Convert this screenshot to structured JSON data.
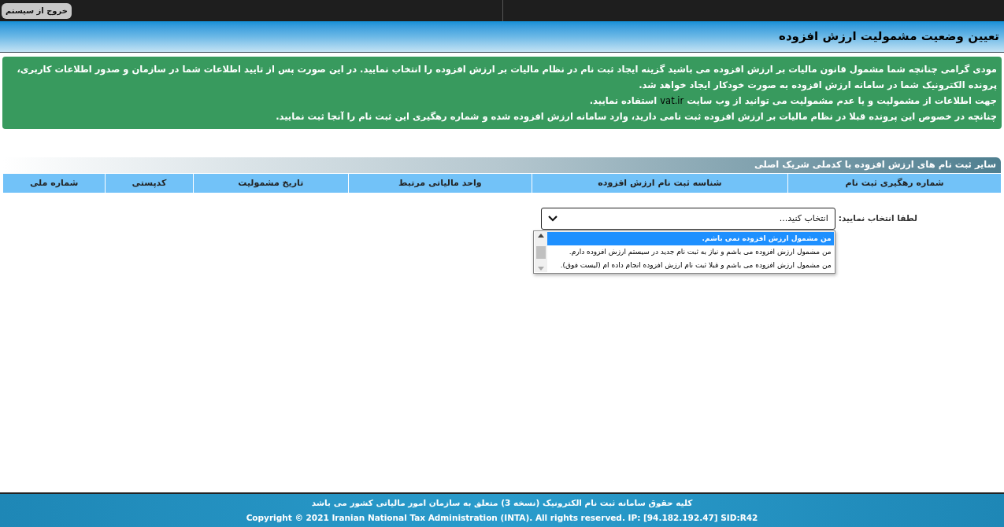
{
  "logout_button": "خروج از سیستم",
  "page_title": "تعیین وضعیت مشمولیت ارزش افزوده",
  "notice": {
    "lines": [
      {
        "text": "مودی گرامی چنانچه شما مشمول قانون مالیات بر ارزش افزوده می باشید گزینه ایجاد ثبت نام در نظام مالیات بر ارزش افزوده را انتخاب نمایید. در این صورت پس از تایید اطلاعات شما در سازمان و صدور اطلاعات کاربری، پرونده الکترونیک شما در سامانه ارزش افزوده به صورت خودکار ایجاد خواهد شد."
      },
      {
        "text": "جهت اطلاعات از مشمولیت و یا عدم مشمولیت می توانید از وب سایت",
        "link": "vat.ir",
        "text_after": "استفاده نمایید."
      },
      {
        "text": "چنانچه در خصوص این پرونده قبلا در نظام مالیات بر ارزش افزوده ثبت نامی دارید، وارد سامانه ارزش افزوده شده و شماره رهگیری این ثبت نام را آنجا ثبت نمایید."
      }
    ]
  },
  "registrations": {
    "title": "سایر ثبت نام های ارزش افزوده با کدملی شریک اصلی",
    "columns": [
      "شماره رهگیری ثبت نام",
      "شناسه ثبت نام ارزش افزوده",
      "واحد مالیاتی مرتبط",
      "تاریخ مشمولیت",
      "کدپستی",
      "شماره ملی"
    ]
  },
  "selection": {
    "label": "لطفا انتخاب نمایید:",
    "value": "انتخاب کنید...",
    "expanded": true,
    "options": [
      {
        "label": "من مشمول ارزش افزوده نمی باشم.",
        "selected": true
      },
      {
        "label": "من مشمول ارزش افزوده می باشم و نیاز به ثبت نام جدید در سیستم ارزش افزوده دارم.",
        "selected": false
      },
      {
        "label": "من مشمول ارزش افزوده می باشم و قبلا ثبت نام ارزش افزوده انجام داده ام (لیست فوق).",
        "selected": false
      }
    ]
  },
  "footer": {
    "lines": [
      "کلیه حقوق سامانه ثبت نام الکترونیک (نسخه 3) متعلق به سازمان امور مالیاتی کشور می باشد",
      "Copyright © 2021 Iranian National Tax Administration (INTA). All rights reserved. IP: [94.182.192.47] SID:R42"
    ]
  }
}
